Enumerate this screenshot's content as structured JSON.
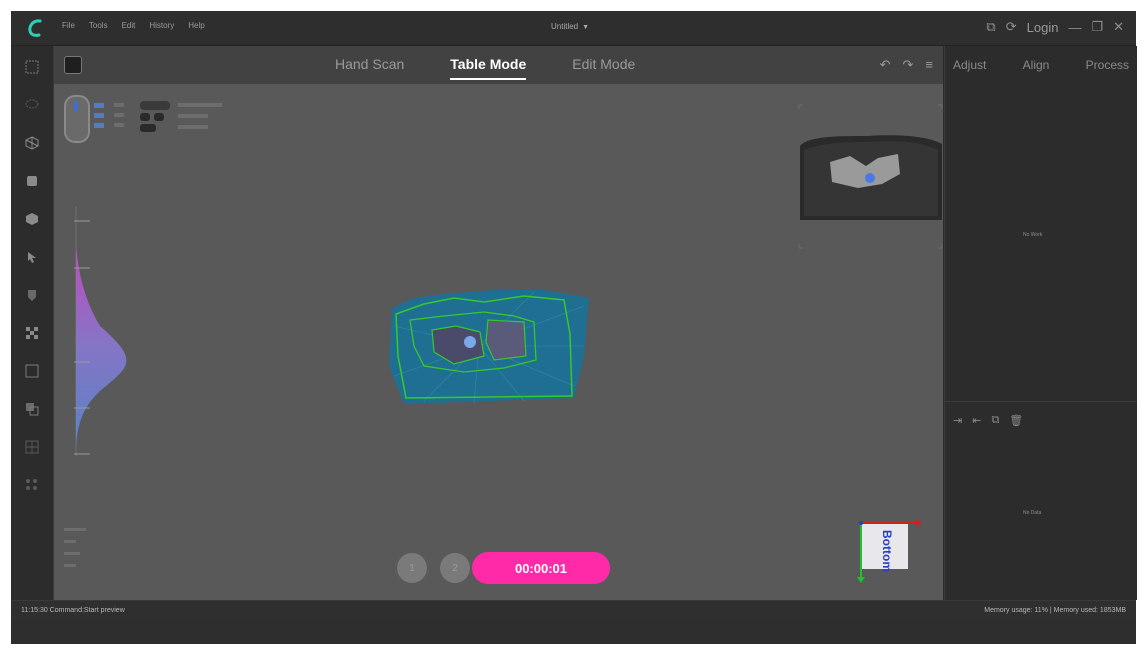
{
  "menu": [
    "File",
    "Tools",
    "Edit",
    "History",
    "Help"
  ],
  "document": {
    "title": "Untitled"
  },
  "window": {
    "login": "Login"
  },
  "left_toolbar": [
    "select-icon",
    "lasso-icon",
    "cube-icon",
    "cylinder-icon",
    "solid-cube-icon",
    "pointer-icon",
    "marker-icon",
    "checker-icon",
    "frame-icon",
    "layers-icon",
    "grid-icon",
    "grid-dots-icon"
  ],
  "modes": {
    "tabs": [
      "Hand Scan",
      "Table Mode",
      "Edit Mode"
    ],
    "active": "Table Mode"
  },
  "right_panel": {
    "tabs": [
      "Adjust",
      "Align",
      "Process"
    ],
    "top_empty": "No Work",
    "bottom_empty": "No Data"
  },
  "viewport": {
    "steps": [
      "1",
      "2"
    ],
    "timer": "00:00:01",
    "orientation": "Bottom"
  },
  "status": {
    "left": "11:15:30 Command:Start preview",
    "right": "Memory usage: 11% | Memory used: 1853MB"
  },
  "colors": {
    "accent": "#ff2aa8",
    "scan_outline": "#36c92a",
    "scan_fill": "#1f6f93"
  }
}
